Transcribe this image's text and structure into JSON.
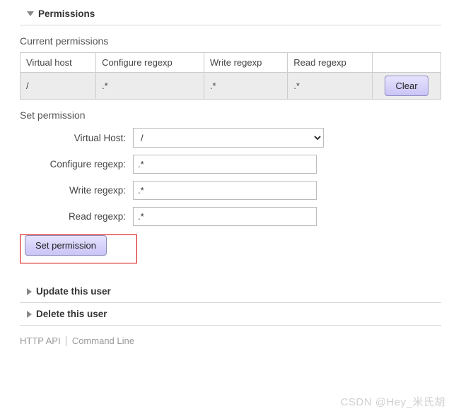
{
  "sections": {
    "permissions_title": "Permissions",
    "update_title": "Update this user",
    "delete_title": "Delete this user"
  },
  "current": {
    "heading": "Current permissions",
    "headers": {
      "vhost": "Virtual host",
      "configure": "Configure regexp",
      "write": "Write regexp",
      "read": "Read regexp"
    },
    "row": {
      "vhost": "/",
      "configure": ".*",
      "write": ".*",
      "read": ".*"
    },
    "clear_label": "Clear"
  },
  "set": {
    "heading": "Set permission",
    "labels": {
      "vhost": "Virtual Host:",
      "configure": "Configure regexp:",
      "write": "Write regexp:",
      "read": "Read regexp:"
    },
    "values": {
      "vhost_selected": "/",
      "configure": ".*",
      "write": ".*",
      "read": ".*"
    },
    "submit_label": "Set permission"
  },
  "footer": {
    "http_api": "HTTP API",
    "cli": "Command Line"
  },
  "watermark": "CSDN @Hey_米氏胡"
}
